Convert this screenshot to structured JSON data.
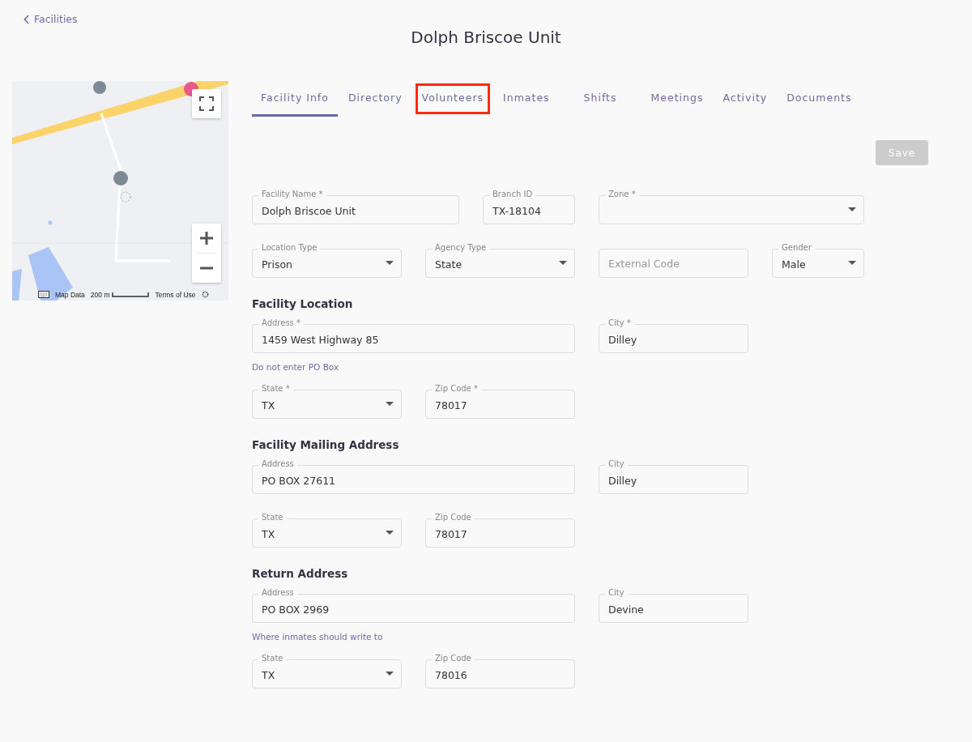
{
  "back_link": {
    "label": "Facilities"
  },
  "title": "Dolph Briscoe Unit",
  "map": {
    "kind": "picture",
    "attribution": [
      "Map Data",
      "200 m",
      "Terms of Use"
    ]
  },
  "tabs": [
    {
      "label": "Facility Info",
      "selected": true,
      "highlighted": false
    },
    {
      "label": "Directory",
      "selected": false,
      "highlighted": false
    },
    {
      "label": "Volunteers",
      "selected": false,
      "highlighted": true
    },
    {
      "label": "Inmates",
      "selected": false,
      "highlighted": false
    },
    {
      "label": "Shifts",
      "selected": false,
      "highlighted": false
    },
    {
      "label": "Meetings",
      "selected": false,
      "highlighted": false
    },
    {
      "label": "Activity",
      "selected": false,
      "highlighted": false
    },
    {
      "label": "Documents",
      "selected": false,
      "highlighted": false
    }
  ],
  "save_button": {
    "label": "Save",
    "disabled": true
  },
  "sections": [
    {
      "rows": [
        {
          "fields": [
            {
              "kind": "text",
              "label": "Facility Name *",
              "value": "Dolph Briscoe Unit"
            },
            {
              "kind": "text",
              "label": "Branch ID",
              "value": "TX-18104"
            },
            {
              "kind": "select",
              "label": "Zone *"
            }
          ]
        },
        {
          "fields": [
            {
              "kind": "select",
              "label": "Location Type",
              "value": "Prison"
            },
            {
              "kind": "select",
              "label": "Agency Type",
              "value": "State"
            },
            {
              "kind": "text",
              "placeholder": "External Code"
            },
            {
              "kind": "select",
              "label": "Gender",
              "value": "Male"
            }
          ]
        }
      ]
    },
    {
      "heading": "Facility Location",
      "rows": [
        {
          "fields": [
            {
              "kind": "text",
              "label": "Address *",
              "value": "1459 West Highway 85"
            },
            {
              "kind": "text",
              "label": "City *",
              "value": "Dilley"
            }
          ],
          "helper": "Do not enter PO Box"
        },
        {
          "fields": [
            {
              "kind": "select",
              "label": "State *",
              "value": "TX"
            },
            {
              "kind": "text",
              "label": "Zip Code *",
              "value": "78017"
            }
          ]
        }
      ]
    },
    {
      "heading": "Facility Mailing Address",
      "rows": [
        {
          "fields": [
            {
              "kind": "text",
              "label": "Address",
              "value": "PO BOX 27611"
            },
            {
              "kind": "text",
              "label": "City",
              "value": "Dilley"
            }
          ]
        },
        {
          "fields": [
            {
              "kind": "select",
              "label": "State",
              "value": "TX"
            },
            {
              "kind": "text",
              "label": "Zip Code",
              "value": "78017"
            }
          ]
        }
      ]
    },
    {
      "heading": "Return Address",
      "rows": [
        {
          "fields": [
            {
              "kind": "text",
              "label": "Address",
              "value": "PO BOX 2969"
            },
            {
              "kind": "text",
              "label": "City",
              "value": "Devine"
            }
          ],
          "helper": "Where inmates should write to"
        },
        {
          "fields": [
            {
              "kind": "select",
              "label": "State",
              "value": "TX"
            },
            {
              "kind": "text",
              "label": "Zip Code",
              "value": "78016"
            }
          ]
        }
      ]
    }
  ]
}
